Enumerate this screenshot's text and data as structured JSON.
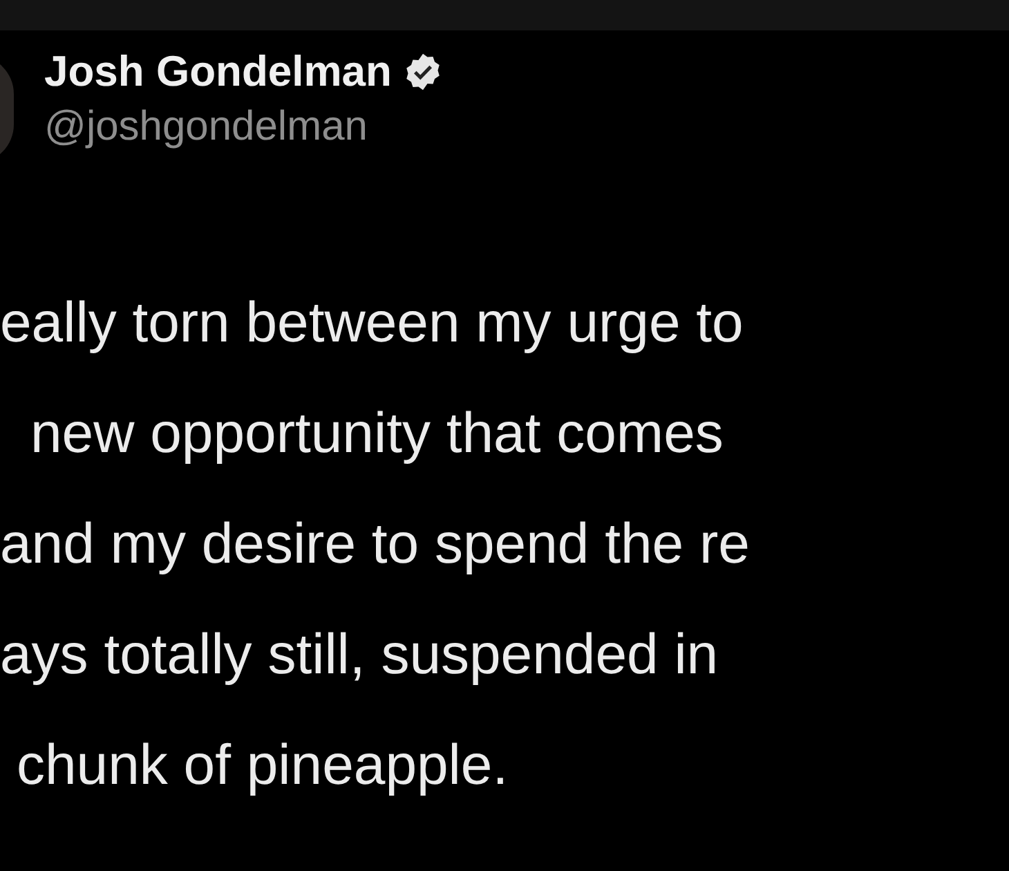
{
  "author": {
    "name": "Josh Gondelman",
    "verified": true,
    "handle": "@joshgondelman"
  },
  "tweet_lines": [
    "eally torn between my urge to",
    "new opportunity that comes",
    "and my desire to spend the re",
    "ays totally still, suspended in",
    "chunk of pineapple."
  ]
}
